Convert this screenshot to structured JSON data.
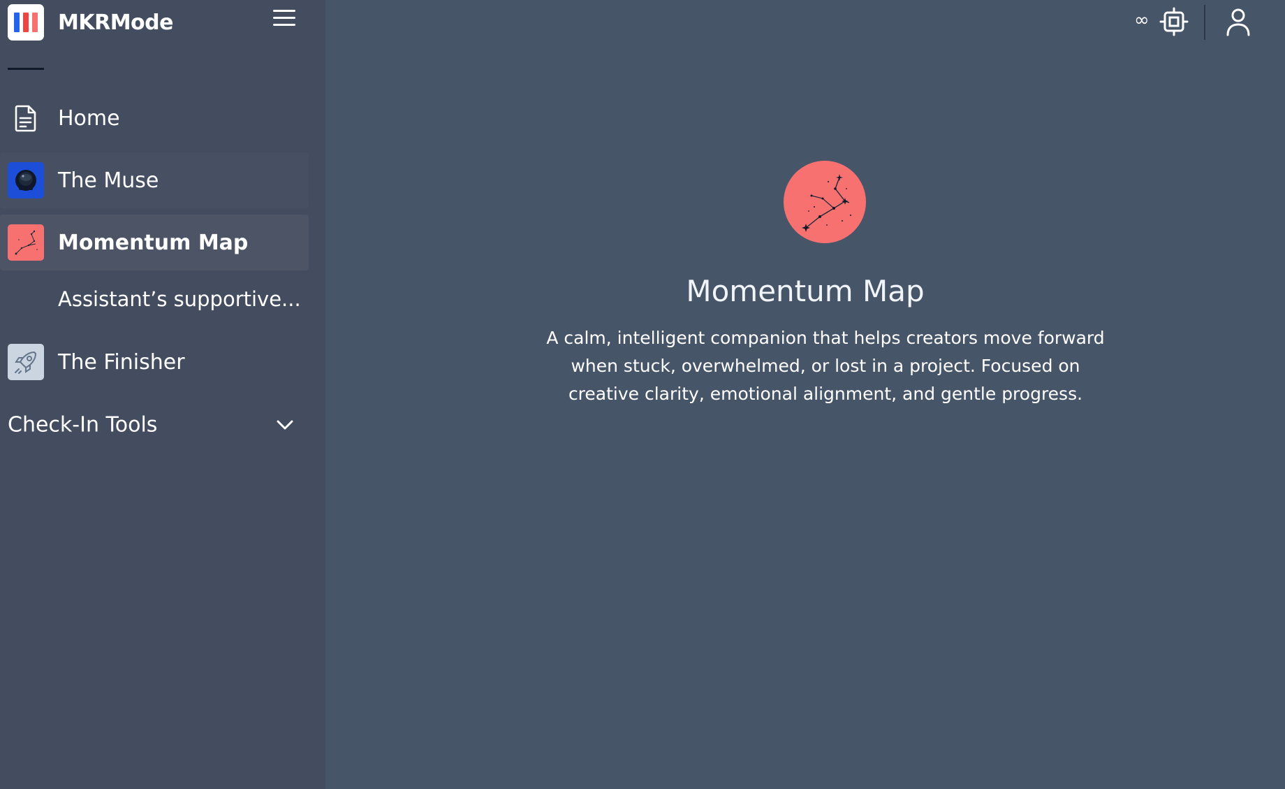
{
  "app": {
    "name": "MKRMode",
    "logo_colors": [
      "#2563eb",
      "#ef4444",
      "#f87171"
    ]
  },
  "sidebar": {
    "items": [
      {
        "label": "Home",
        "icon": "document-icon"
      },
      {
        "label": "The Muse",
        "icon": "astronaut-helmet-icon",
        "color": "#1d4ed8"
      },
      {
        "label": "Momentum Map",
        "icon": "constellation-icon",
        "color": "#f87171",
        "active": true
      },
      {
        "label": "Assistant’s supportive...",
        "subitem": true
      },
      {
        "label": "The Finisher",
        "icon": "rocket-icon",
        "color": "#cbd5e1"
      }
    ],
    "section": {
      "label": "Check-In Tools",
      "icon": "chevron-down-icon"
    }
  },
  "topbar": {
    "credits_symbol": "∞",
    "credits_icon": "chip-icon",
    "user_icon": "user-icon"
  },
  "main": {
    "title": "Momentum Map",
    "description": "A calm, intelligent companion that helps creators move forward when stuck, overwhelmed, or lost in a project. Focused on creative clarity, emotional alignment, and gentle progress.",
    "avatar_color": "#f87171"
  }
}
